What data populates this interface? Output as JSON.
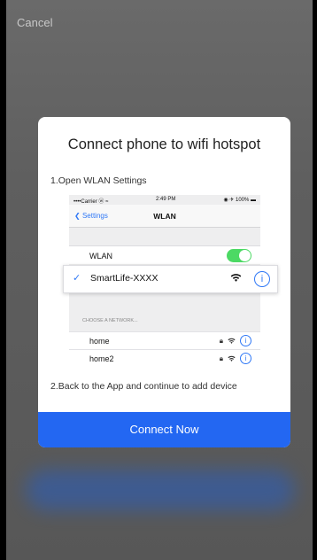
{
  "top": {
    "cancel_label": "Cancel"
  },
  "modal": {
    "title": "Connect phone to wifi hotspot",
    "step1": "1.Open WLAN Settings",
    "step2": "2.Back to the App and continue to add device",
    "connect_button": "Connect Now"
  },
  "phone": {
    "status": {
      "carrier": "••••Carrier ⓦ ≈",
      "time": "2:49 PM",
      "battery": "◉ ✈ 100% ▬"
    },
    "back_label": "Settings",
    "nav_title": "WLAN",
    "wlan_label": "WLAN",
    "wlan_toggle_on": true,
    "selected_network": "SmartLife-XXXX",
    "choose_header": "CHOOSE A NETWORK...",
    "networks": [
      {
        "name": "home"
      },
      {
        "name": "home2"
      }
    ]
  },
  "colors": {
    "accent": "#2367f2",
    "ios_blue": "#2f78f6",
    "toggle_green": "#4cd964"
  }
}
